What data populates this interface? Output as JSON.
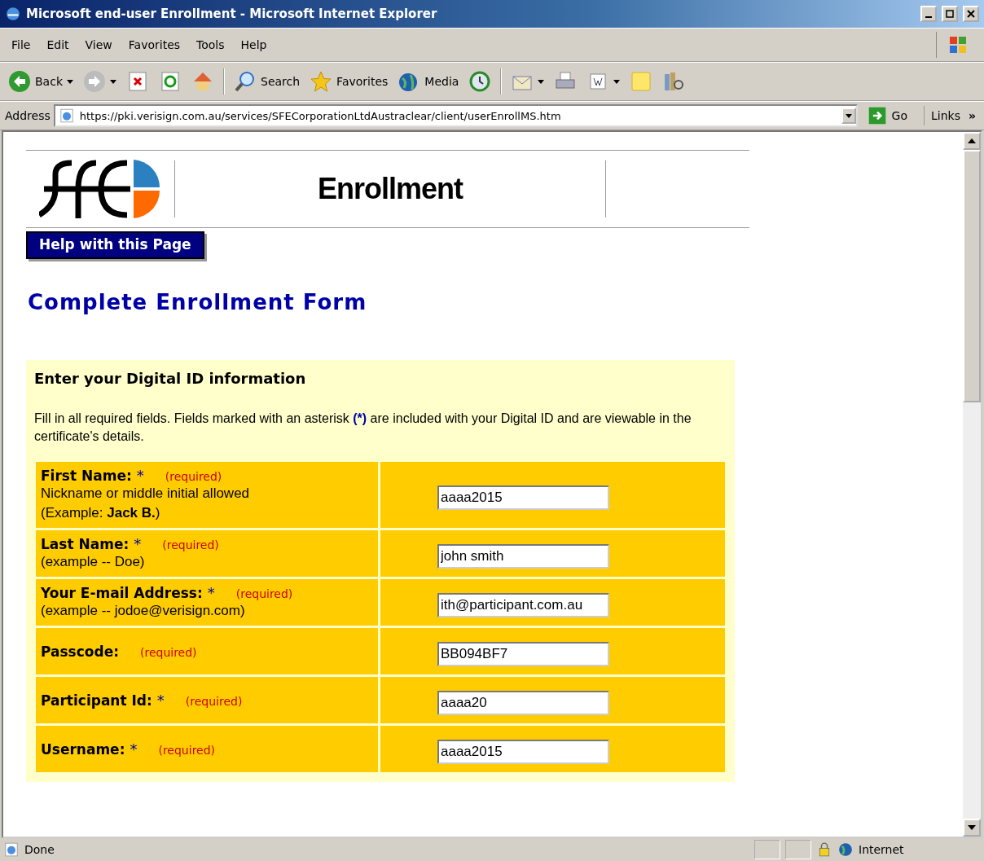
{
  "window": {
    "title": "Microsoft end-user Enrollment - Microsoft Internet Explorer"
  },
  "menu": [
    "File",
    "Edit",
    "View",
    "Favorites",
    "Tools",
    "Help"
  ],
  "toolbar": [
    {
      "kind": "back",
      "label": "Back",
      "has_menu": true
    },
    {
      "kind": "forward",
      "has_menu": true,
      "disabled": true
    },
    {
      "kind": "stop"
    },
    {
      "kind": "refresh"
    },
    {
      "kind": "home"
    },
    {
      "kind": "search",
      "label": "Search"
    },
    {
      "kind": "favorites",
      "label": "Favorites"
    },
    {
      "kind": "media",
      "label": "Media"
    },
    {
      "kind": "history"
    },
    {
      "kind": "mail",
      "has_menu": true
    },
    {
      "kind": "print"
    },
    {
      "kind": "edit",
      "has_menu": true
    },
    {
      "kind": "note"
    },
    {
      "kind": "research"
    }
  ],
  "address_bar": {
    "label": "Address",
    "url": "https://pki.verisign.com.au/services/SFECorporationLtdAustraclear/client/userEnrollMS.htm",
    "go": "Go",
    "links": "Links",
    "links_more": "»"
  },
  "page": {
    "header": "Enrollment",
    "help_button": "Help with this Page",
    "form_title": "Complete Enrollment Form",
    "panel": {
      "title": "Enter your Digital ID information",
      "intro": "Fill in all required fields. Fields marked with an asterisk **(*)** are included with your Digital ID and are viewable in the certificate's details.",
      "fields": [
        {
          "label": "First Name:",
          "star": "*",
          "required": "(required)",
          "hints": [
            "Nickname or middle initial allowed",
            "(Example: **Jack B.**)"
          ],
          "value": "aaaa2015"
        },
        {
          "label": "Last Name:",
          "star": "*",
          "required": "(required)",
          "hints": [
            "(example -- Doe)"
          ],
          "value": "john smith"
        },
        {
          "label": "Your E-mail Address:",
          "star": "*",
          "required": "(required)",
          "hints": [
            "(example -- jodoe@verisign.com)"
          ],
          "value": "ith@participant.com.au"
        },
        {
          "label": "Passcode:",
          "required": "(required)",
          "value": "BB094BF7"
        },
        {
          "label": "Participant Id:",
          "star": "*",
          "required": "(required)",
          "value": "aaaa20"
        },
        {
          "label": "Username:",
          "star": "*",
          "required": "(required)",
          "value": "aaaa2015"
        }
      ]
    }
  },
  "status_bar": {
    "text": "Done",
    "zone": "Internet"
  }
}
